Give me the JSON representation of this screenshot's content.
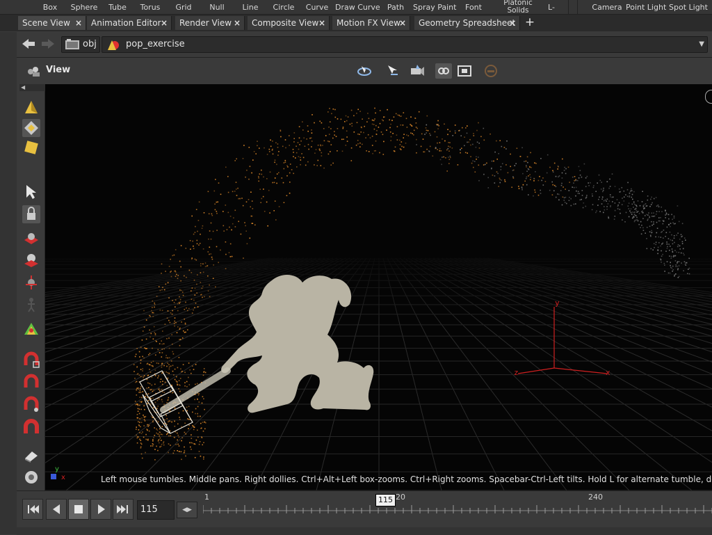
{
  "shelf": {
    "tools": [
      {
        "label": "Box"
      },
      {
        "label": "Sphere"
      },
      {
        "label": "Tube"
      },
      {
        "label": "Torus"
      },
      {
        "label": "Grid"
      },
      {
        "label": "Null"
      },
      {
        "label": "Line"
      },
      {
        "label": "Circle"
      },
      {
        "label": "Curve"
      },
      {
        "label": "Draw Curve"
      },
      {
        "label": "Path"
      },
      {
        "label": "Spray Paint"
      },
      {
        "label": "Font"
      },
      {
        "label": "Platonic Solids"
      },
      {
        "label": "L-"
      },
      {
        "label": "Camera"
      },
      {
        "label": "Point Light"
      },
      {
        "label": "Spot Light"
      }
    ],
    "platonic_line1": "Platonic",
    "platonic_line2": "Solids"
  },
  "tabs": [
    {
      "label": "Scene View"
    },
    {
      "label": "Animation Editor"
    },
    {
      "label": "Render View"
    },
    {
      "label": "Composite View"
    },
    {
      "label": "Motion FX View"
    },
    {
      "label": "Geometry Spreadsheet"
    }
  ],
  "add_tab_glyph": "+",
  "path": {
    "root": "obj",
    "node": "pop_exercise"
  },
  "viewport": {
    "view_label": "View",
    "status_message": "Left mouse tumbles. Middle pans. Right dollies. Ctrl+Alt+Left box-zooms. Ctrl+Right zooms. Spacebar-Ctrl-Left tilts. Hold L for alternate tumble, dolly, and",
    "axis_x": "x",
    "axis_y": "y",
    "axis_z": "z",
    "corner_y": "y",
    "corner_x": "x"
  },
  "timeline": {
    "current_frame": "115",
    "marker_label": "115",
    "tick_labels": [
      {
        "label": "1",
        "frame": 1
      },
      {
        "label": "120",
        "frame": 120
      },
      {
        "label": "240",
        "frame": 240
      }
    ]
  },
  "colors": {
    "particle_orange": "#e08a2a",
    "particle_grey": "#7a7a7a",
    "character": "#b9b4a4",
    "axis_red": "#d02020",
    "accent_orange": "#d8a040"
  }
}
